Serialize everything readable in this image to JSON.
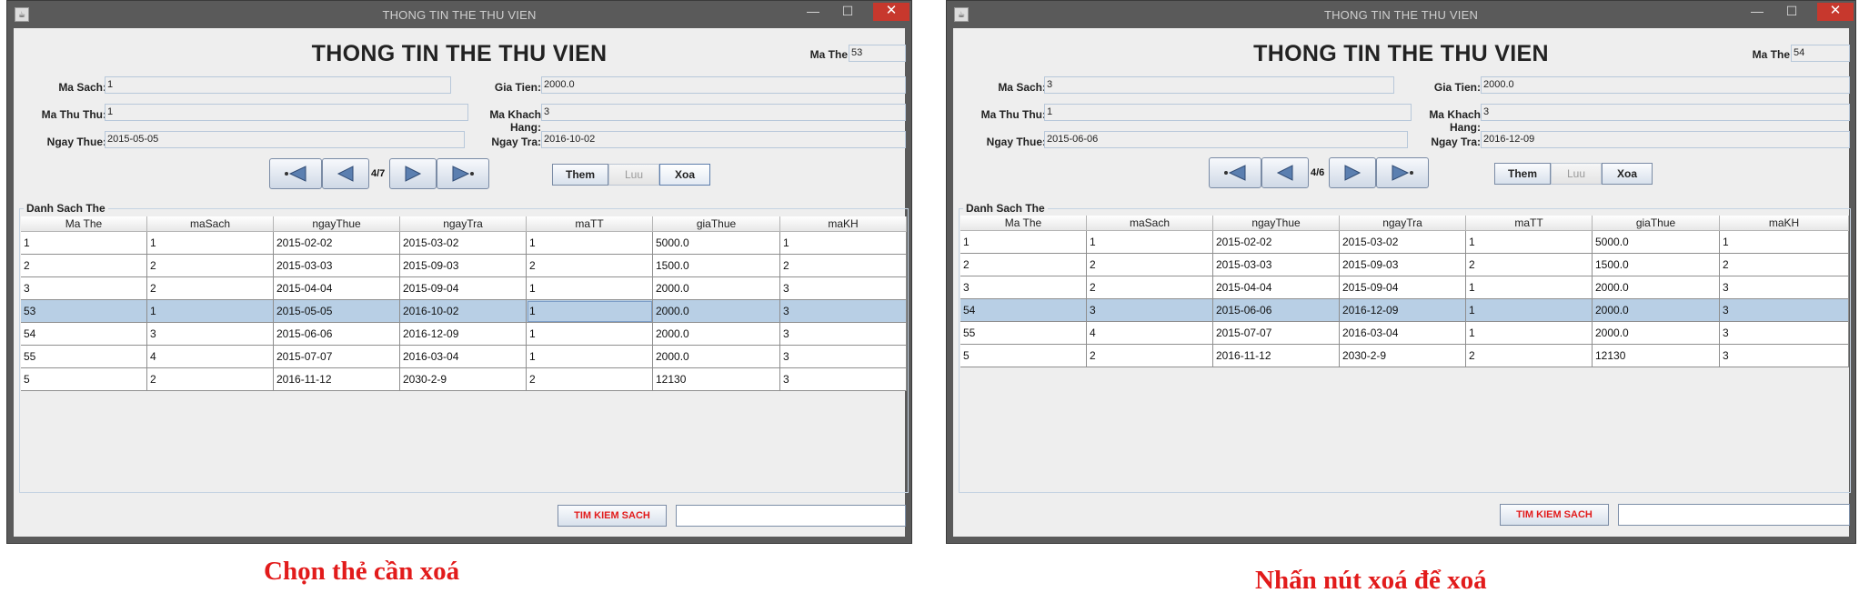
{
  "windows": [
    {
      "title": "THONG TIN THE THU VIEN",
      "heading": "THONG TIN THE THU VIEN",
      "form": {
        "ma_the": {
          "label": "Ma The",
          "value": "53"
        },
        "ma_sach": {
          "label": "Ma Sach:",
          "value": "1"
        },
        "gia_tien": {
          "label": "Gia Tien:",
          "value": "2000.0"
        },
        "ma_thu_thu": {
          "label": "Ma Thu Thu:",
          "value": "1"
        },
        "ma_khach_hang": {
          "label": "Ma Khach Hang:",
          "value": "3"
        },
        "ngay_thue": {
          "label": "Ngay Thue:",
          "value": "2015-05-05"
        },
        "ngay_tra": {
          "label": "Ngay Tra:",
          "value": "2016-10-02"
        }
      },
      "page_counter": "4/7",
      "actions": {
        "them": "Them",
        "luu": "Luu",
        "xoa": "Xoa"
      },
      "section_title": "Danh Sach The",
      "columns": [
        "Ma The",
        "maSach",
        "ngayThue",
        "ngayTra",
        "maTT",
        "giaThue",
        "maKH"
      ],
      "rows": [
        [
          "1",
          "1",
          "2015-02-02",
          "2015-03-02",
          "1",
          "5000.0",
          "1"
        ],
        [
          "2",
          "2",
          "2015-03-03",
          "2015-09-03",
          "2",
          "1500.0",
          "2"
        ],
        [
          "3",
          "2",
          "2015-04-04",
          "2015-09-04",
          "1",
          "2000.0",
          "3"
        ],
        [
          "53",
          "1",
          "2015-05-05",
          "2016-10-02",
          "1",
          "2000.0",
          "3"
        ],
        [
          "54",
          "3",
          "2015-06-06",
          "2016-12-09",
          "1",
          "2000.0",
          "3"
        ],
        [
          "55",
          "4",
          "2015-07-07",
          "2016-03-04",
          "1",
          "2000.0",
          "3"
        ],
        [
          "5",
          "2",
          "2016-11-12",
          "2030-2-9",
          "2",
          "12130",
          "3"
        ]
      ],
      "selected_row": 3,
      "search_button": "TIM KIEM SACH",
      "search_value": ""
    },
    {
      "title": "THONG TIN THE THU VIEN",
      "heading": "THONG TIN THE THU VIEN",
      "form": {
        "ma_the": {
          "label": "Ma The",
          "value": "54"
        },
        "ma_sach": {
          "label": "Ma Sach:",
          "value": "3"
        },
        "gia_tien": {
          "label": "Gia Tien:",
          "value": "2000.0"
        },
        "ma_thu_thu": {
          "label": "Ma Thu Thu:",
          "value": "1"
        },
        "ma_khach_hang": {
          "label": "Ma Khach Hang:",
          "value": "3"
        },
        "ngay_thue": {
          "label": "Ngay Thue:",
          "value": "2015-06-06"
        },
        "ngay_tra": {
          "label": "Ngay Tra:",
          "value": "2016-12-09"
        }
      },
      "page_counter": "4/6",
      "actions": {
        "them": "Them",
        "luu": "Luu",
        "xoa": "Xoa"
      },
      "section_title": "Danh Sach The",
      "columns": [
        "Ma The",
        "maSach",
        "ngayThue",
        "ngayTra",
        "maTT",
        "giaThue",
        "maKH"
      ],
      "rows": [
        [
          "1",
          "1",
          "2015-02-02",
          "2015-03-02",
          "1",
          "5000.0",
          "1"
        ],
        [
          "2",
          "2",
          "2015-03-03",
          "2015-09-03",
          "2",
          "1500.0",
          "2"
        ],
        [
          "3",
          "2",
          "2015-04-04",
          "2015-09-04",
          "1",
          "2000.0",
          "3"
        ],
        [
          "54",
          "3",
          "2015-06-06",
          "2016-12-09",
          "1",
          "2000.0",
          "3"
        ],
        [
          "55",
          "4",
          "2015-07-07",
          "2016-03-04",
          "1",
          "2000.0",
          "3"
        ],
        [
          "5",
          "2",
          "2016-11-12",
          "2030-2-9",
          "2",
          "12130",
          "3"
        ]
      ],
      "selected_row": 3,
      "search_button": "TIM KIEM SACH",
      "search_value": ""
    }
  ],
  "captions": {
    "left": "Chọn thẻ cần xoá",
    "right": "Nhấn nút xoá để xoá"
  },
  "colors": {
    "caption": "#e21b1b",
    "selection": "#b8cfe5",
    "close_button": "#c7382d"
  }
}
